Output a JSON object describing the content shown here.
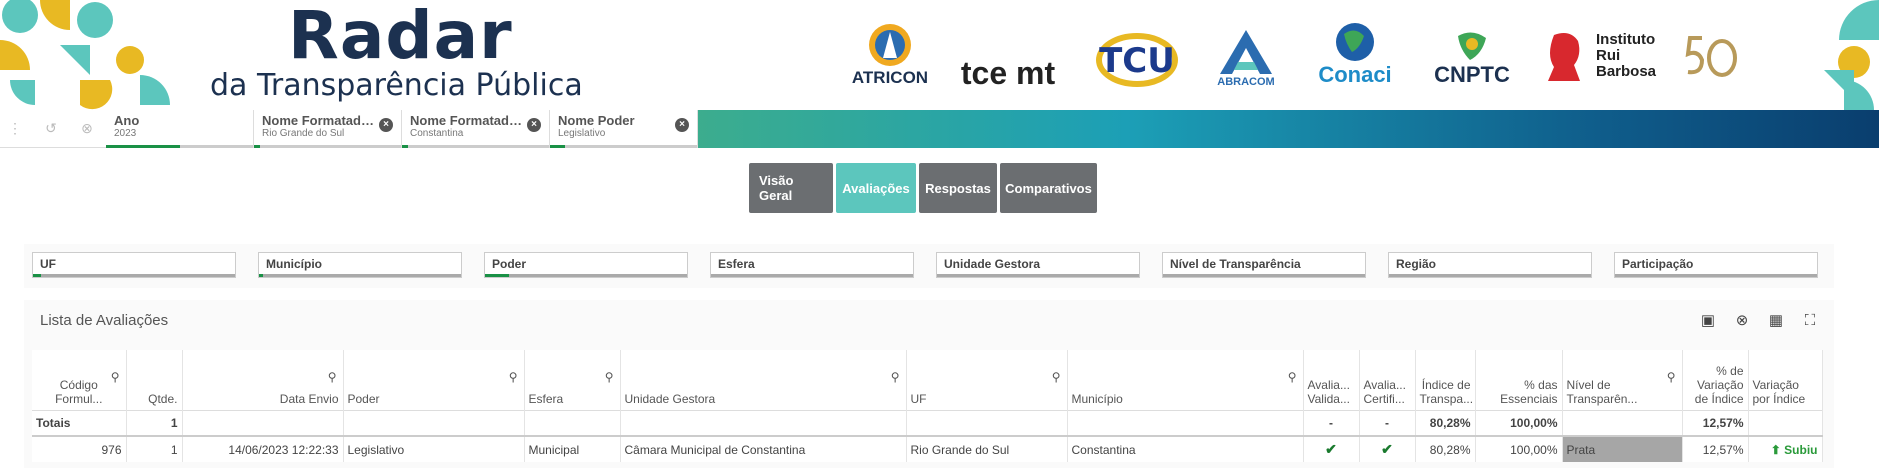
{
  "header": {
    "title": "Radar",
    "subtitle": "da Transparência Pública",
    "logos": [
      "ATRICON",
      "tce mt",
      "TCU",
      "ABRACOM",
      "Conaci",
      "CNPTC",
      "Instituto Rui Barbosa"
    ]
  },
  "selections": [
    {
      "name": "Ano",
      "value": "2023",
      "fill_pct": 50
    },
    {
      "name": "Nome Formatado ...",
      "value": "Rio Grande do Sul",
      "fill_pct": 4
    },
    {
      "name": "Nome Formatado ...",
      "value": "Constantina",
      "fill_pct": 4
    },
    {
      "name": "Nome Poder",
      "value": "Legislativo",
      "fill_pct": 10
    }
  ],
  "tabs": [
    {
      "label": "Visão Geral"
    },
    {
      "label": "Avaliações"
    },
    {
      "label": "Respostas"
    },
    {
      "label": "Comparativos"
    }
  ],
  "filters": [
    {
      "label": "UF",
      "fill_pct": 4
    },
    {
      "label": "Município",
      "fill_pct": 2
    },
    {
      "label": "Poder",
      "fill_pct": 12
    },
    {
      "label": "Esfera",
      "fill_pct": 0
    },
    {
      "label": "Unidade Gestora",
      "fill_pct": 0
    },
    {
      "label": "Nível de Transparência",
      "fill_pct": 0
    },
    {
      "label": "Região",
      "fill_pct": 0
    },
    {
      "label": "Participação",
      "fill_pct": 0
    }
  ],
  "panel": {
    "title": "Lista de Avaliações",
    "columns": [
      "Código Formul...",
      "Qtde.",
      "Data Envio",
      "Poder",
      "Esfera",
      "Unidade Gestora",
      "UF",
      "Município",
      "Avalia... Valida...",
      "Avalia... Certifi...",
      "Índice de Transpa...",
      "% das Essenciais",
      "Nível de Transparên...",
      "% de Variação de Índice",
      "Variação por Índice"
    ],
    "totals": {
      "label": "Totais",
      "qtde": "1",
      "val": "-",
      "cert": "-",
      "indice": "80,28%",
      "essenciais": "100,00%",
      "variacao": "12,57%"
    },
    "rows": [
      {
        "codigo": "976",
        "qtde": "1",
        "data": "14/06/2023 12:22:33",
        "poder": "Legislativo",
        "esfera": "Municipal",
        "unidade": "Câmara Municipal de Constantina",
        "uf": "Rio Grande do Sul",
        "municipio": "Constantina",
        "indice": "80,28%",
        "essenciais": "100,00%",
        "nivel": "Prata",
        "variacao": "12,57%",
        "variacao_por": "Subiu"
      }
    ]
  }
}
